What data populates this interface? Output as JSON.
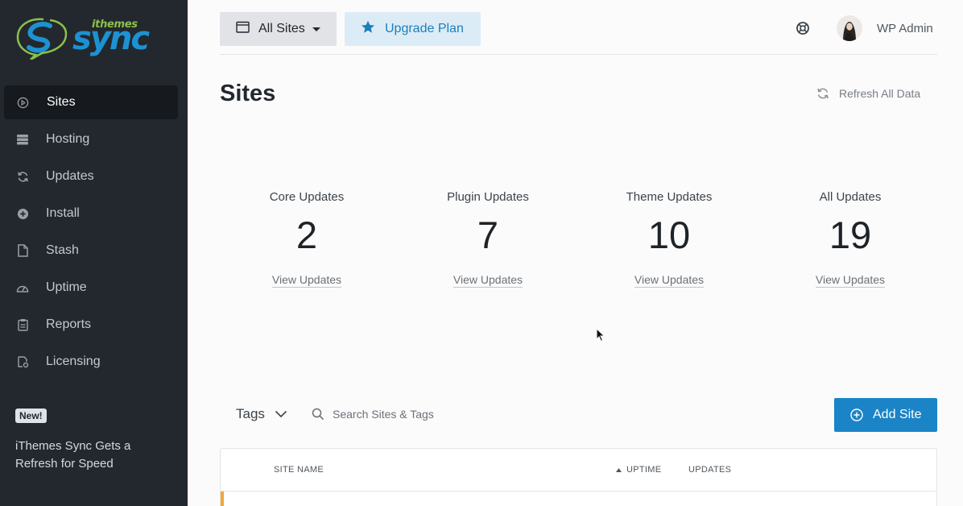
{
  "brand": {
    "small": "ithemes",
    "big": "sync"
  },
  "sidebar": {
    "items": [
      {
        "label": "Sites",
        "icon": "play-circle-icon",
        "active": true
      },
      {
        "label": "Hosting",
        "icon": "server-icon"
      },
      {
        "label": "Updates",
        "icon": "refresh-icon"
      },
      {
        "label": "Install",
        "icon": "plus-circle-icon"
      },
      {
        "label": "Stash",
        "icon": "document-icon"
      },
      {
        "label": "Uptime",
        "icon": "gauge-icon"
      },
      {
        "label": "Reports",
        "icon": "clipboard-icon"
      },
      {
        "label": "Licensing",
        "icon": "license-icon"
      }
    ],
    "badge": "New!",
    "promo": "iThemes Sync Gets a Refresh for Speed"
  },
  "topbar": {
    "sites_button": "All Sites",
    "upgrade_button": "Upgrade Plan",
    "user_name": "WP Admin"
  },
  "header": {
    "title": "Sites",
    "refresh_label": "Refresh All Data"
  },
  "stats": [
    {
      "label": "Core Updates",
      "value": "2",
      "link": "View Updates"
    },
    {
      "label": "Plugin Updates",
      "value": "7",
      "link": "View Updates"
    },
    {
      "label": "Theme Updates",
      "value": "10",
      "link": "View Updates"
    },
    {
      "label": "All Updates",
      "value": "19",
      "link": "View Updates"
    }
  ],
  "toolbar": {
    "tags_label": "Tags",
    "search_placeholder": "Search Sites & Tags",
    "add_site_label": "Add Site"
  },
  "table": {
    "columns": [
      "SITE NAME",
      "UPTIME",
      "UPDATES"
    ],
    "sorted_column": "UPTIME"
  },
  "colors": {
    "sidebar_bg": "#23282f",
    "accent_blue": "#1a84c6",
    "upgrade_bg": "#dcecf7",
    "row_accent": "#f0a838"
  }
}
